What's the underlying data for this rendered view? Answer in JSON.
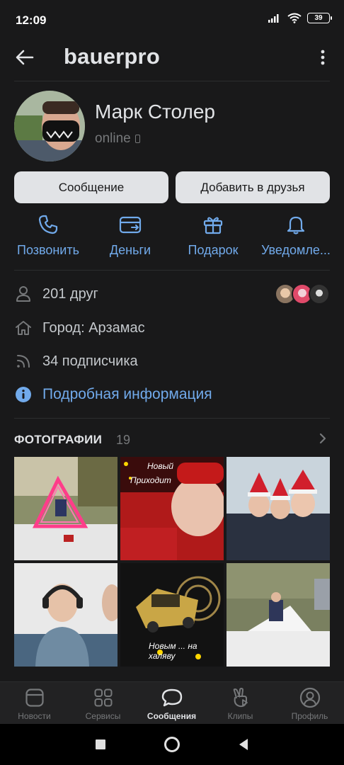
{
  "status_bar": {
    "time": "12:09",
    "battery": "39"
  },
  "header": {
    "title": "bauerpro"
  },
  "profile": {
    "name": "Марк Столер",
    "status": "online"
  },
  "buttons": {
    "message": "Сообщение",
    "add_friend": "Добавить в друзья"
  },
  "actions": [
    {
      "label": "Позвонить",
      "icon": "phone-icon"
    },
    {
      "label": "Деньги",
      "icon": "wallet-icon"
    },
    {
      "label": "Подарок",
      "icon": "gift-icon"
    },
    {
      "label": "Уведомле...",
      "icon": "bell-icon"
    }
  ],
  "info": {
    "friends": "201 друг",
    "city": "Город: Арзамас",
    "followers": "34 подписчика",
    "more": "Подробная информация"
  },
  "photos": {
    "title": "ФОТОГРАФИИ",
    "count": "19",
    "captions": {
      "p2_line1": "Новый",
      "p2_line2": "Приходит",
      "p5": "Новым ... на халяву"
    }
  },
  "tabbar": [
    {
      "label": "Новости",
      "icon": "news-icon"
    },
    {
      "label": "Сервисы",
      "icon": "services-icon"
    },
    {
      "label": "Сообщения",
      "icon": "messages-icon"
    },
    {
      "label": "Клипы",
      "icon": "clips-icon"
    },
    {
      "label": "Профиль",
      "icon": "profile-icon"
    }
  ],
  "colors": {
    "background": "#19191a",
    "accent": "#71aaeb",
    "button": "#e1e3e6",
    "text_secondary": "#76787a"
  }
}
